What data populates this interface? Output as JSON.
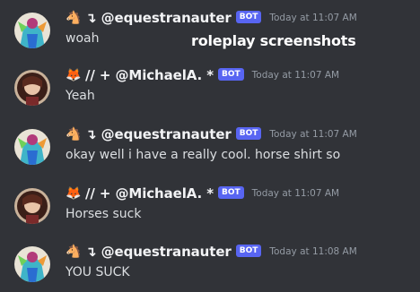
{
  "overlay_text": "roleplay screenshots",
  "messages": [
    {
      "avatar": "equestranauter-avatar",
      "emoji_icon": "horse-emoji-icon",
      "emoji_char": "🐴",
      "username": "↴ @equestranauter",
      "badge": "BOT",
      "timestamp": "Today at 11:07 AM",
      "content": "woah"
    },
    {
      "avatar": "michaela-avatar",
      "emoji_icon": "fox-emoji-icon",
      "emoji_char": "🦊",
      "username": "// + @MichaelA. *",
      "badge": "BOT",
      "timestamp": "Today at 11:07 AM",
      "content": "Yeah"
    },
    {
      "avatar": "equestranauter-avatar",
      "emoji_icon": "horse-emoji-icon",
      "emoji_char": "🐴",
      "username": "↴ @equestranauter",
      "badge": "BOT",
      "timestamp": "Today at 11:07 AM",
      "content": "okay well i have a really cool. horse shirt so"
    },
    {
      "avatar": "michaela-avatar",
      "emoji_icon": "fox-emoji-icon",
      "emoji_char": "🦊",
      "username": "// + @MichaelA. *",
      "badge": "BOT",
      "timestamp": "Today at 11:07 AM",
      "content": "Horses suck"
    },
    {
      "avatar": "equestranauter-avatar",
      "emoji_icon": "horse-emoji-icon",
      "emoji_char": "🐴",
      "username": "↴ @equestranauter",
      "badge": "BOT",
      "timestamp": "Today at 11:08 AM",
      "content": "YOU SUCK"
    }
  ],
  "colors": {
    "background": "#313338",
    "bot_badge": "#5865f2",
    "username": "#f2f3f5",
    "timestamp": "#949ba4",
    "message_text": "#dbdee1"
  }
}
